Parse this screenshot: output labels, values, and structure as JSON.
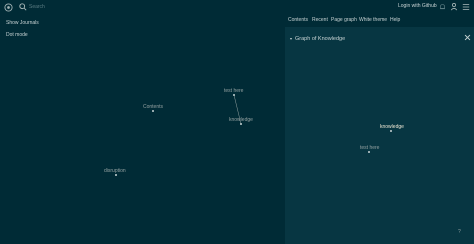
{
  "header": {
    "search_placeholder": "Search",
    "login_label": "Login with Github",
    "icons": [
      "logo-icon",
      "search-icon",
      "bell-icon",
      "user-icon",
      "menu-icon"
    ]
  },
  "left_options": [
    "Show Journals",
    "Dot mode"
  ],
  "graph": {
    "nodes": [
      "test here",
      "Contents",
      "knowledge",
      "disruption"
    ]
  },
  "sidebar": {
    "tabs": [
      "Contents",
      "Recent",
      "Page graph",
      "White theme",
      "Help"
    ],
    "panel_title": "Graph of Knowledge",
    "nodes": [
      "knowledge",
      "test here"
    ],
    "help_label": "?"
  },
  "colors": {
    "background": "#002b36",
    "sidebar": "#073642",
    "text": "#c7d3d4"
  }
}
